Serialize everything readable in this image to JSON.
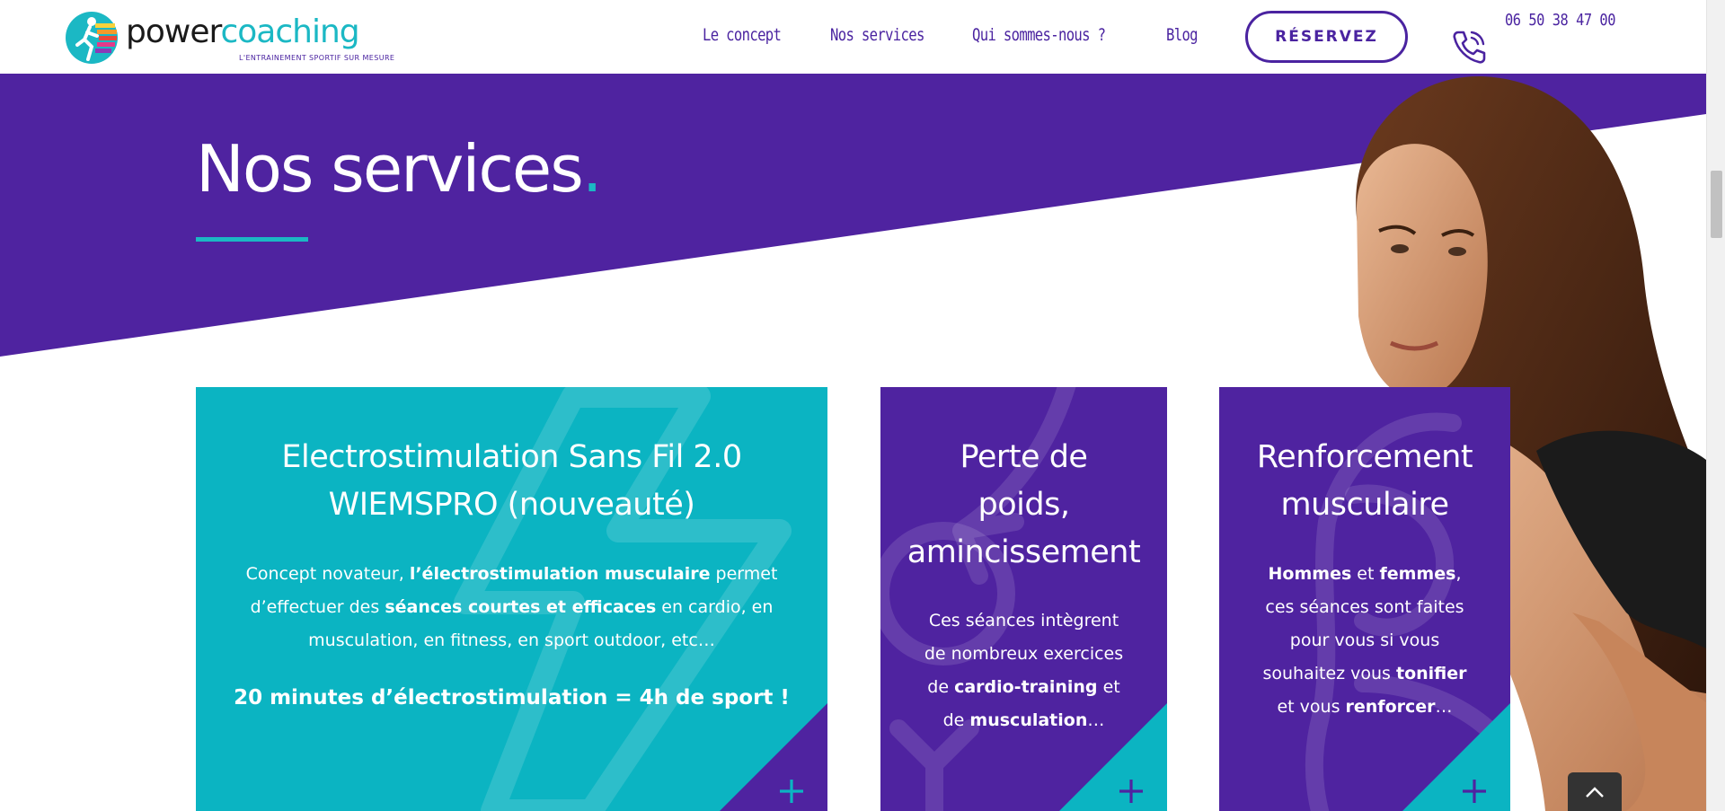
{
  "header": {
    "logo": {
      "word_part1": "power",
      "word_part2": "coaching",
      "tagline": "L'ENTRAINEMENT SPORTIF SUR MESURE"
    },
    "nav": [
      {
        "label": "Le concept"
      },
      {
        "label": "Nos services"
      },
      {
        "label": "Qui sommes-nous ?"
      },
      {
        "label": "Blog"
      }
    ],
    "reserve_label": "RÉSERVEZ",
    "phone": "06 50 38 47 00"
  },
  "hero": {
    "title": "Nos services",
    "title_dot": "."
  },
  "cards": [
    {
      "title_line1": "Electrostimulation Sans Fil 2.0",
      "title_line2": "WIEMSPRO (nouveauté)",
      "l1a": "Concept novateur, ",
      "l1b": "l’électrostimulation musculaire",
      "l1c": " permet",
      "l2a": "d’effectuer des ",
      "l2b": "séances courtes et efficaces",
      "l2c": " en cardio, en",
      "l3": "musculation, en fitness, en sport outdoor, etc…",
      "highlight": "20 minutes d’électrostimulation = 4h de sport !"
    },
    {
      "title_line1": "Perte de",
      "title_line2": "poids,",
      "title_line3": "amincissement",
      "l1": "Ces séances intègrent",
      "l2": "de nombreux exercices",
      "l3a": "de ",
      "l3b": "cardio-training",
      "l3c": " et",
      "l4a": "de ",
      "l4b": "musculation",
      "l4c": "…"
    },
    {
      "title_line1": "Renforcement",
      "title_line2": "musculaire",
      "l1a": "Hommes",
      "l1b": " et ",
      "l1c": "femmes",
      "l1d": ",",
      "l2": "ces séances sont faites",
      "l3": "pour vous si vous",
      "l4a": "souhaitez vous ",
      "l4b": "tonifier",
      "l5a": "et vous ",
      "l5b": "renforcer",
      "l5c": "…"
    }
  ],
  "colors": {
    "purple": "#4f23a0",
    "teal": "#0bb4c2",
    "white": "#ffffff"
  },
  "icons": {
    "phone": "phone-icon",
    "plus": "plus-icon",
    "scroll_top": "chevron-up-icon"
  }
}
